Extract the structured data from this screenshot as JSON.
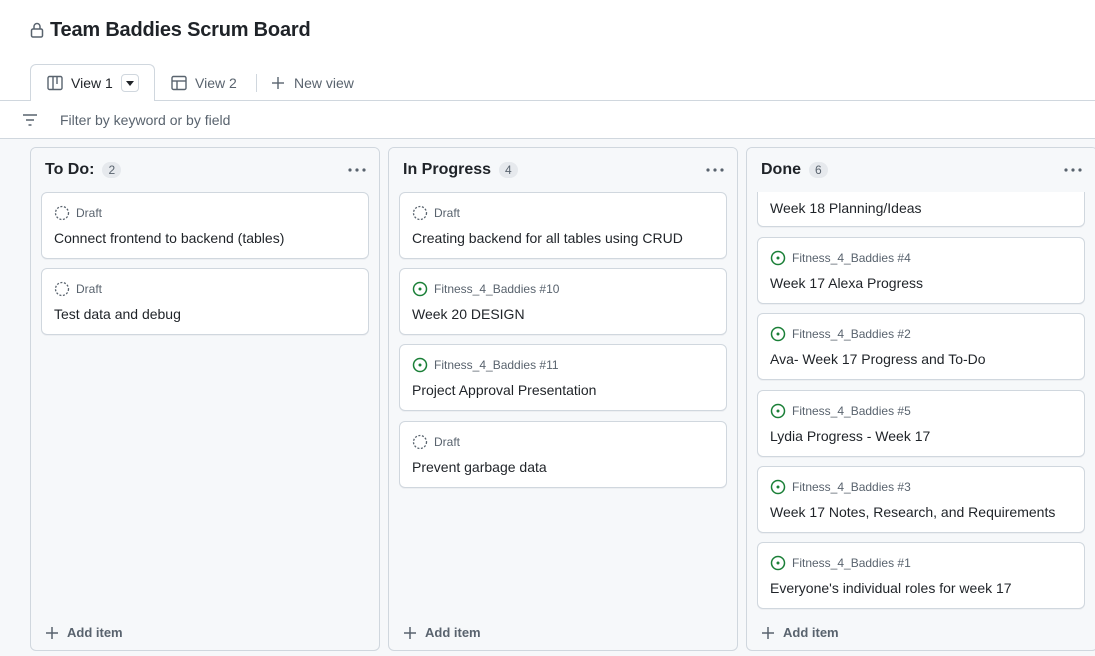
{
  "board": {
    "title": "Team Baddies Scrum Board",
    "icons": {
      "lock": "lock-icon",
      "filter": "filter-icon",
      "more": "kebab-horizontal-icon",
      "add": "plus-icon"
    }
  },
  "tabs": [
    {
      "label": "View 1",
      "icon": "board-icon",
      "active": true
    },
    {
      "label": "View 2",
      "icon": "table-icon",
      "active": false
    },
    {
      "label": "New view",
      "icon": "plus-icon",
      "active": false
    }
  ],
  "filter": {
    "placeholder": "Filter by keyword or by field",
    "value": ""
  },
  "columns": [
    {
      "name": "To Do:",
      "count": "2",
      "add_label": "Add item",
      "cards": [
        {
          "status": "Draft",
          "type": "draft",
          "title": "Connect frontend to backend (tables)"
        },
        {
          "status": "Draft",
          "type": "draft",
          "title": "Test data and debug"
        }
      ]
    },
    {
      "name": "In Progress",
      "count": "4",
      "add_label": "Add item",
      "cards": [
        {
          "status": "Draft",
          "type": "draft",
          "title": "Creating backend for all tables using CRUD"
        },
        {
          "status": "Fitness_4_Baddies #10",
          "type": "issue",
          "title": "Week 20 DESIGN"
        },
        {
          "status": "Fitness_4_Baddies #11",
          "type": "issue",
          "title": "Project Approval Presentation"
        },
        {
          "status": "Draft",
          "type": "draft",
          "title": "Prevent garbage data"
        }
      ]
    },
    {
      "name": "Done",
      "count": "6",
      "add_label": "Add item",
      "cards": [
        {
          "status": "",
          "type": "cut",
          "title": "Week 18 Planning/Ideas"
        },
        {
          "status": "Fitness_4_Baddies #4",
          "type": "issue",
          "title": "Week 17 Alexa Progress"
        },
        {
          "status": "Fitness_4_Baddies #2",
          "type": "issue",
          "title": "Ava- Week 17 Progress and To-Do"
        },
        {
          "status": "Fitness_4_Baddies #5",
          "type": "issue",
          "title": "Lydia Progress - Week 17"
        },
        {
          "status": "Fitness_4_Baddies #3",
          "type": "issue",
          "title": "Week 17 Notes, Research, and Requirements"
        },
        {
          "status": "Fitness_4_Baddies #1",
          "type": "issue",
          "title": "Everyone's individual roles for week 17"
        }
      ]
    }
  ],
  "colors": {
    "issue_open": "#1a7f37",
    "muted": "#59636e",
    "border": "#d0d7de",
    "board_bg": "#f6f8fa"
  }
}
